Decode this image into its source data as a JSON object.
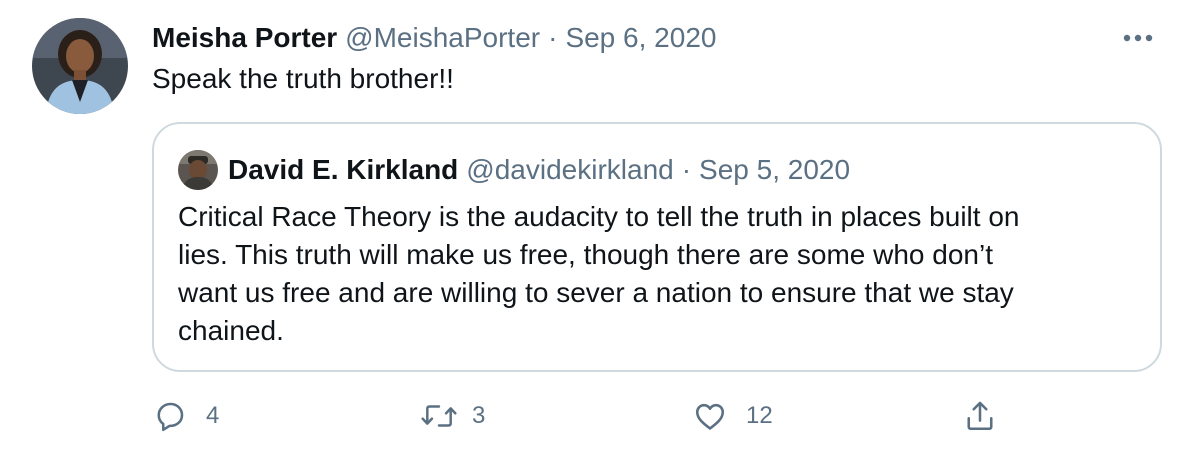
{
  "tweet": {
    "author": {
      "name": "Meisha Porter",
      "handle": "@MeishaPorter",
      "avatar_icon": "profile-photo"
    },
    "separator": "·",
    "timestamp": "Sep 6, 2020",
    "text": "Speak the truth brother!!",
    "more_icon": "more-icon"
  },
  "quoted_tweet": {
    "author": {
      "name": "David E. Kirkland",
      "handle": "@davidekirkland",
      "avatar_icon": "profile-photo"
    },
    "separator": "·",
    "timestamp": "Sep 5, 2020",
    "lines": [
      "Critical Race Theory is the audacity to tell the truth in places built on",
      "lies. This truth will make us free, though there are some who don’t",
      "want us free and are willing to sever a nation to ensure that we stay",
      "chained."
    ]
  },
  "actions": {
    "reply": {
      "icon": "reply-icon",
      "count": "4"
    },
    "retweet": {
      "icon": "retweet-icon",
      "count": "3"
    },
    "like": {
      "icon": "like-icon",
      "count": "12"
    },
    "share": {
      "icon": "share-icon"
    }
  },
  "colors": {
    "text_primary": "#0f1419",
    "text_secondary": "#5b7083",
    "border": "#cfd9de",
    "background": "#ffffff"
  }
}
